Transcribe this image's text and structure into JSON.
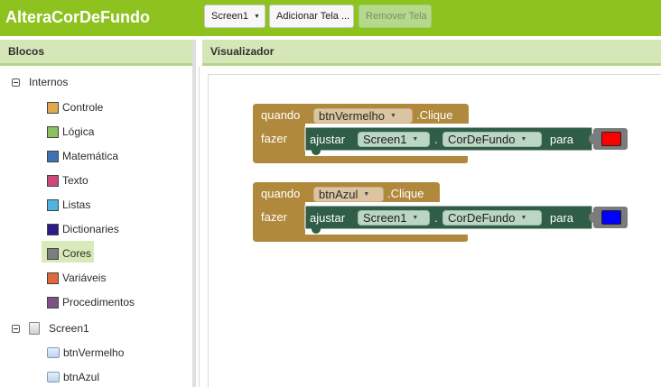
{
  "app": {
    "title": "AlteraCorDeFundo"
  },
  "toolbar": {
    "screen_select": "Screen1",
    "add_screen": "Adicionar Tela ...",
    "remove_screen": "Remover Tela"
  },
  "panels": {
    "blocks_title": "Blocos",
    "viewer_title": "Visualizador"
  },
  "tree": {
    "builtin_label": "Internos",
    "builtin_items": [
      {
        "label": "Controle",
        "color": "#e1a94b"
      },
      {
        "label": "Lógica",
        "color": "#8cc063"
      },
      {
        "label": "Matemática",
        "color": "#3f71b5"
      },
      {
        "label": "Texto",
        "color": "#c94a7a"
      },
      {
        "label": "Listas",
        "color": "#4fb3e1"
      },
      {
        "label": "Dictionaries",
        "color": "#2d1b8a"
      },
      {
        "label": "Cores",
        "color": "#7d7d7d"
      },
      {
        "label": "Variáveis",
        "color": "#e0683d"
      },
      {
        "label": "Procedimentos",
        "color": "#7c5385"
      }
    ],
    "screen_label": "Screen1",
    "components": [
      {
        "label": "btnVermelho"
      },
      {
        "label": "btnAzul"
      }
    ]
  },
  "blocks": [
    {
      "when_label": "quando",
      "component": "btnVermelho",
      "event": ".Clique",
      "do_label": "fazer",
      "set_label": "ajustar",
      "target": "Screen1",
      "dot": ".",
      "property": "CorDeFundo",
      "to_label": "para",
      "color_value": "#ff0000"
    },
    {
      "when_label": "quando",
      "component": "btnAzul",
      "event": ".Clique",
      "do_label": "fazer",
      "set_label": "ajustar",
      "target": "Screen1",
      "dot": ".",
      "property": "CorDeFundo",
      "to_label": "para",
      "color_value": "#0000ff"
    }
  ],
  "colors": {
    "topbar": "#8dc21f",
    "event_block": "#b1893c",
    "setter_block": "#2f5d48"
  }
}
